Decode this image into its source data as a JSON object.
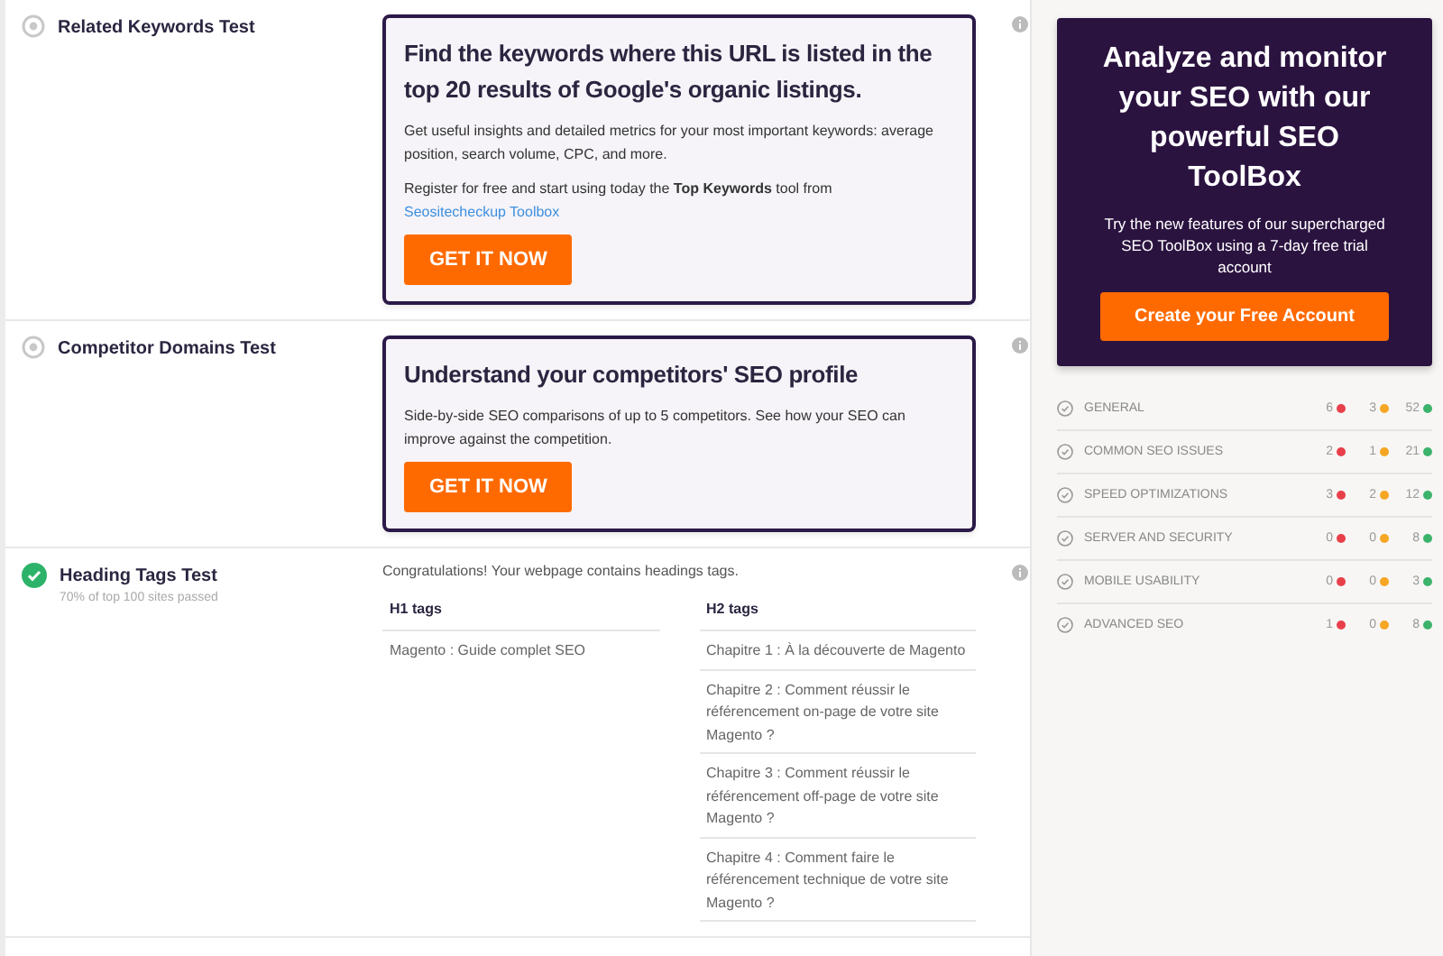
{
  "tests": [
    {
      "kind": "promo",
      "passed": false,
      "title": "Related Keywords Test",
      "card": {
        "heading": "Find the keywords where this URL is listed in the top 20 results of Google's organic listings.",
        "paragraphs": [
          {
            "text": "Get useful insights and detailed metrics for your most important keywords: average position, search volume, CPC, and more."
          },
          {
            "text": "Register for free and start using today the **Top Keywords** tool from",
            "link": "Seositecheckup Toolbox"
          }
        ],
        "button": "GET IT NOW"
      }
    },
    {
      "kind": "promo",
      "passed": false,
      "title": "Competitor Domains Test",
      "card": {
        "heading": "Understand your competitors' SEO profile",
        "paragraphs": [
          {
            "text": "Side-by-side SEO comparisons of up to 5 competitors. See how your SEO can improve against the competition."
          }
        ],
        "button": "GET IT NOW"
      }
    },
    {
      "kind": "headings",
      "passed": true,
      "title": "Heading Tags Test",
      "subtitle": "70% of top 100 sites passed",
      "message": "Congratulations! Your webpage contains headings tags.",
      "columns": [
        {
          "header": "H1 tags",
          "items": [
            "Magento : Guide complet SEO"
          ]
        },
        {
          "header": "H2 tags",
          "items": [
            "Chapitre 1 : À la découverte de Magento",
            "Chapitre 2 : Comment réussir le référencement on-page de votre site Magento ?",
            "Chapitre 3 : Comment réussir le référencement off-page de votre site Magento ?",
            "Chapitre 4 : Comment faire le référencement technique de votre site Magento ?"
          ]
        }
      ]
    }
  ],
  "sidebar": {
    "promo": {
      "heading": "Analyze and monitor your SEO with our powerful SEO ToolBox",
      "text": "Try the new features of our supercharged SEO ToolBox using a 7-day free trial account",
      "button": "Create your Free Account"
    },
    "categories": [
      {
        "label": "GENERAL",
        "counts": [
          {
            "value": "6",
            "color": "#e8404a"
          },
          {
            "value": "3",
            "color": "#f5a623"
          },
          {
            "value": "52",
            "color": "#3cb36b"
          }
        ]
      },
      {
        "label": "COMMON SEO ISSUES",
        "counts": [
          {
            "value": "2",
            "color": "#e8404a"
          },
          {
            "value": "1",
            "color": "#f5a623"
          },
          {
            "value": "21",
            "color": "#3cb36b"
          }
        ]
      },
      {
        "label": "SPEED OPTIMIZATIONS",
        "counts": [
          {
            "value": "3",
            "color": "#e8404a"
          },
          {
            "value": "2",
            "color": "#f5a623"
          },
          {
            "value": "12",
            "color": "#3cb36b"
          }
        ]
      },
      {
        "label": "SERVER AND SECURITY",
        "counts": [
          {
            "value": "0",
            "color": "#e8404a"
          },
          {
            "value": "0",
            "color": "#f5a623"
          },
          {
            "value": "8",
            "color": "#3cb36b"
          }
        ]
      },
      {
        "label": "MOBILE USABILITY",
        "counts": [
          {
            "value": "0",
            "color": "#e8404a"
          },
          {
            "value": "0",
            "color": "#f5a623"
          },
          {
            "value": "3",
            "color": "#3cb36b"
          }
        ]
      },
      {
        "label": "ADVANCED SEO",
        "counts": [
          {
            "value": "1",
            "color": "#e8404a"
          },
          {
            "value": "0",
            "color": "#f5a623"
          },
          {
            "value": "8",
            "color": "#3cb36b"
          }
        ]
      }
    ]
  }
}
